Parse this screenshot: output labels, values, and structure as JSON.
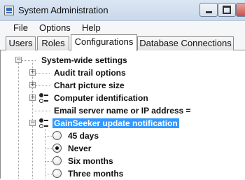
{
  "window": {
    "title": "System Administration"
  },
  "menu": {
    "items": [
      "File",
      "Options",
      "Help"
    ]
  },
  "tabs": [
    {
      "label": "Users"
    },
    {
      "label": "Roles"
    },
    {
      "label": "Configurations",
      "active": true
    },
    {
      "label": "Database Connections"
    }
  ],
  "tree": {
    "root": "System-wide settings",
    "items": [
      {
        "label": "Audit trail options",
        "type": "folder"
      },
      {
        "label": "Chart picture size",
        "type": "folder"
      },
      {
        "label": "Computer identification",
        "type": "option-group"
      },
      {
        "label": "Email server name or IP address =",
        "type": "value"
      },
      {
        "label": "GainSeeker update notification",
        "type": "option-group",
        "selected": true,
        "expanded": true
      }
    ],
    "radio_options": [
      {
        "label": "45 days",
        "checked": false
      },
      {
        "label": "Never",
        "checked": true
      },
      {
        "label": "Six months",
        "checked": false
      },
      {
        "label": "Three months",
        "checked": false
      }
    ]
  },
  "colors": {
    "selection": "#3399ff",
    "titlebar": "#c9d8ea"
  },
  "icons": [
    "app-icon",
    "minimize-icon",
    "maximize-icon",
    "close-icon",
    "option-group-icon",
    "radio-icon"
  ]
}
